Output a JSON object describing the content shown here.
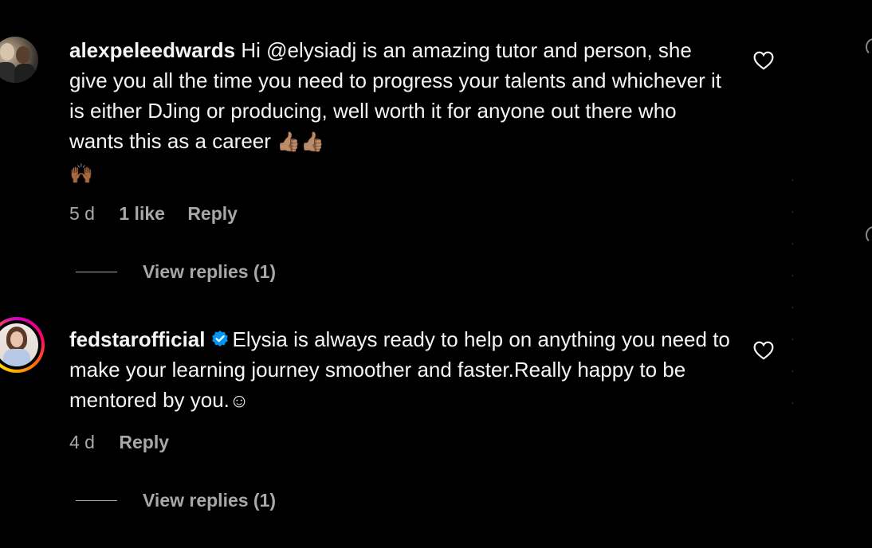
{
  "comments": [
    {
      "username": "alexpeleedwards",
      "text": "Hi @elysiadj is an amazing tutor and person, she give you all the time you need to progress your talents and whichever it is either DJing or producing, well worth it for anyone out there who wants this as a career",
      "emojis": "👍🏽👍🏽",
      "emojis2": "🙌🏾",
      "time": "5 d",
      "likes": "1 like",
      "reply_label": "Reply",
      "view_replies": "View replies (1)",
      "verified": false
    },
    {
      "username": "fedstarofficial",
      "text": "Elysia is always ready to help on anything you need to make your learning journey smoother and faster.Really happy to be mentored by you.",
      "emojis": "☺",
      "time": "4 d",
      "reply_label": "Reply",
      "view_replies": "View replies (1)",
      "verified": true
    }
  ],
  "colors": {
    "background": "#000000",
    "primary_text": "#f5f5f5",
    "secondary_text": "#a8a8a8",
    "verified_badge": "#0095f6"
  },
  "icons": {
    "like": "heart-outline-icon",
    "verified": "verified-badge-icon"
  }
}
